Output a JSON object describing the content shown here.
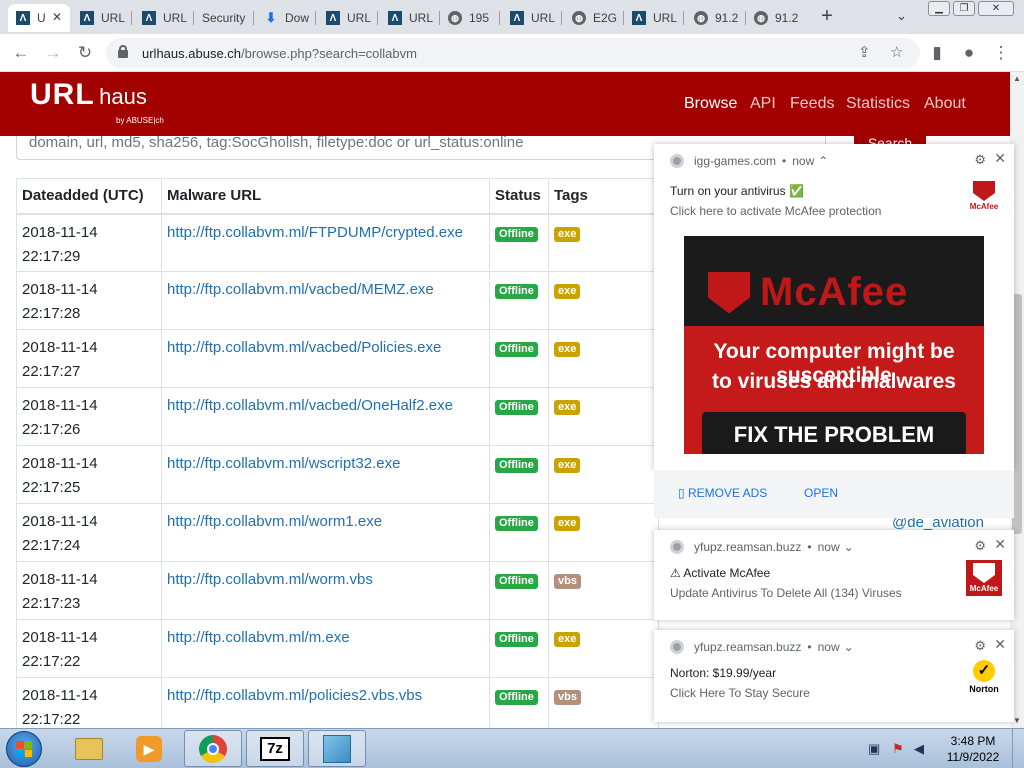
{
  "browser": {
    "tabs": [
      {
        "icon": "urlhaus-icon",
        "title": "U",
        "active": true
      },
      {
        "icon": "urlhaus-icon",
        "title": "URL"
      },
      {
        "icon": "urlhaus-icon",
        "title": "URL"
      },
      {
        "icon": "blank-icon",
        "title": "Security"
      },
      {
        "icon": "download-icon",
        "title": "Dow"
      },
      {
        "icon": "urlhaus-icon",
        "title": "URL"
      },
      {
        "icon": "urlhaus-icon",
        "title": "URL"
      },
      {
        "icon": "globe-icon",
        "title": "195"
      },
      {
        "icon": "urlhaus-icon",
        "title": "URL"
      },
      {
        "icon": "globe-icon",
        "title": "E2G"
      },
      {
        "icon": "urlhaus-icon",
        "title": "URL"
      },
      {
        "icon": "globe-icon",
        "title": "91.2"
      },
      {
        "icon": "globe-icon",
        "title": "91.2"
      }
    ],
    "close_symbol": "✕",
    "newtab_symbol": "+",
    "tabsearch_symbol": "⌄",
    "window_controls": {
      "minimize": "▁",
      "restore": "❐",
      "close": "✕"
    },
    "nav": {
      "back": "←",
      "forward": "→",
      "reload": "↻"
    },
    "address": {
      "host": "urlhaus.abuse.ch",
      "path": "/browse.php?search=collabvm"
    },
    "omnibox_icons": {
      "share": "⇪",
      "bookmark": "☆"
    },
    "toolbar_icons": {
      "sidepanel": "▮",
      "profile": "●",
      "menu": "⋮"
    }
  },
  "site": {
    "brand": {
      "main": "URL",
      "sub": "haus",
      "by": "by ABUSE|ch"
    },
    "nav": [
      {
        "label": "Browse",
        "active": true
      },
      {
        "label": "API"
      },
      {
        "label": "Feeds"
      },
      {
        "label": "Statistics"
      },
      {
        "label": "About"
      }
    ],
    "search": {
      "placeholder": "domain, url, md5, sha256, tag:SocGholish, filetype:doc or url_status:online",
      "button": "Search"
    },
    "table": {
      "headers": [
        "Dateadded (UTC)",
        "Malware URL",
        "Status",
        "Tags"
      ],
      "rows": [
        {
          "date": "2018-11-14",
          "time": "22:17:29",
          "url": "http://ftp.collabvm.ml/FTPDUMP/crypted.exe",
          "status": "Offline",
          "tag": "exe"
        },
        {
          "date": "2018-11-14",
          "time": "22:17:28",
          "url": "http://ftp.collabvm.ml/vacbed/MEMZ.exe",
          "status": "Offline",
          "tag": "exe"
        },
        {
          "date": "2018-11-14",
          "time": "22:17:27",
          "url": "http://ftp.collabvm.ml/vacbed/Policies.exe",
          "status": "Offline",
          "tag": "exe"
        },
        {
          "date": "2018-11-14",
          "time": "22:17:26",
          "url": "http://ftp.collabvm.ml/vacbed/OneHalf2.exe",
          "status": "Offline",
          "tag": "exe"
        },
        {
          "date": "2018-11-14",
          "time": "22:17:25",
          "url": "http://ftp.collabvm.ml/wscript32.exe",
          "status": "Offline",
          "tag": "exe"
        },
        {
          "date": "2018-11-14",
          "time": "22:17:24",
          "url": "http://ftp.collabvm.ml/worm1.exe",
          "status": "Offline",
          "tag": "exe"
        },
        {
          "date": "2018-11-14",
          "time": "22:17:23",
          "url": "http://ftp.collabvm.ml/worm.vbs",
          "status": "Offline",
          "tag": "vbs"
        },
        {
          "date": "2018-11-14",
          "time": "22:17:22",
          "url": "http://ftp.collabvm.ml/m.exe",
          "status": "Offline",
          "tag": "exe"
        },
        {
          "date": "2018-11-14",
          "time": "22:17:22",
          "url": "http://ftp.collabvm.ml/policies2.vbs.vbs",
          "status": "Offline",
          "tag": "vbs"
        }
      ]
    },
    "reporter": "@de_aviation"
  },
  "notifications": [
    {
      "source": "igg-games.com",
      "when": "now",
      "chevron": "⌃",
      "title": "Turn on your antivirus ✅",
      "body": "Click here to activate McAfee protection",
      "logo_word": "McAfee",
      "ad": {
        "brand": "McAfee",
        "line1": "Your computer might be susceptible",
        "line2": "to viruses and malwares",
        "cta": "FIX THE PROBLEM"
      },
      "actions": [
        "▯ REMOVE ADS",
        "OPEN"
      ]
    },
    {
      "source": "yfupz.reamsan.buzz",
      "when": "now",
      "chevron": "⌄",
      "title": "⚠ Activate McAfee",
      "body": "Update Antivirus To Delete All (134) Viruses",
      "logo_word": "McAfee"
    },
    {
      "source": "yfupz.reamsan.buzz",
      "when": "now",
      "chevron": "⌄",
      "title": "Norton: $19.99/year",
      "body": "Click Here To Stay Secure",
      "logo_word": "Norton"
    }
  ],
  "notif_icons": {
    "gear": "⚙",
    "close": "✕",
    "dot": "•"
  },
  "taskbar": {
    "apps": [
      "explorer",
      "media-player",
      "chrome",
      "7-zip",
      "package"
    ],
    "app_7z_label": "7z",
    "clock": {
      "time": "3:48 PM",
      "date": "11/9/2022"
    }
  },
  "colors": {
    "brand_red": "#a30000",
    "link": "#1f6fb2",
    "offline_green": "#28a745",
    "exe_tag": "#c9a400",
    "vbs_tag": "#b3907a"
  }
}
